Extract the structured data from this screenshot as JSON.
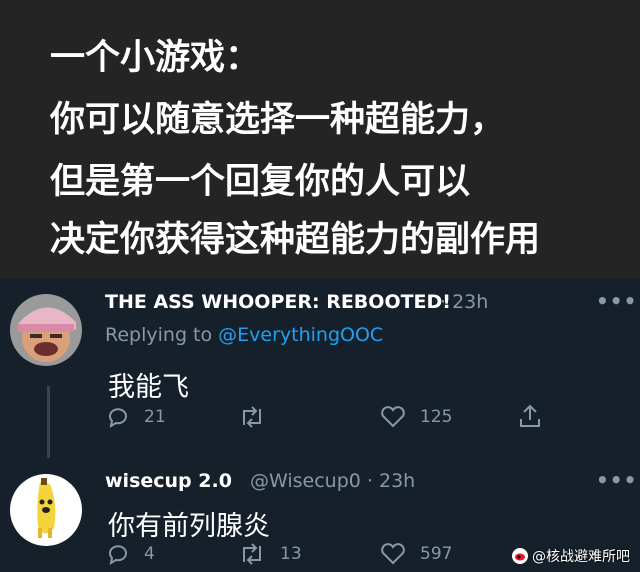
{
  "caption": {
    "lines": [
      "一个小游戏：",
      "你可以随意选择一种超能力，",
      "但是第一个回复你的人可以",
      "决定你获得这种超能力的副作用"
    ]
  },
  "tweets": [
    {
      "name": "THE ASS WHOOPER: REBOOTED!",
      "time": "· 23h",
      "reply_prefix": "Replying to ",
      "reply_handle": "@EverythingOOC",
      "text": "我能飞",
      "replies": "21",
      "retweets": "",
      "likes": "125"
    },
    {
      "name": "wisecup 2.0",
      "handle_time": "@Wisecup0 · 23h",
      "text": "你有前列腺炎",
      "replies": "4",
      "retweets": "13",
      "likes": "597"
    }
  ],
  "more_icon": "•••",
  "watermark": {
    "text": "@核战避难所吧",
    "icon": "weibo-icon"
  },
  "colors": {
    "background": "#15202b",
    "caption_bg": "#242424",
    "link": "#1da1f2",
    "muted": "#8899a6"
  }
}
